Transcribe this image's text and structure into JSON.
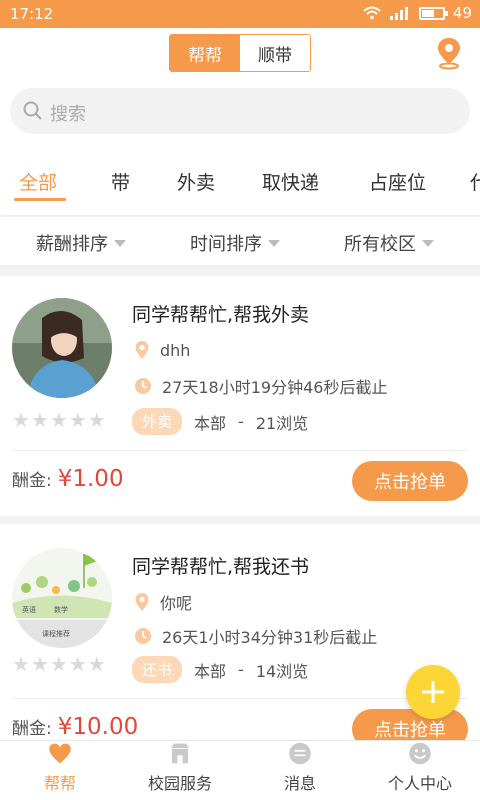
{
  "status_bar": {
    "time": "17:12",
    "battery": "49"
  },
  "header": {
    "segments": [
      "帮帮",
      "顺带"
    ],
    "active_segment": 0
  },
  "search": {
    "placeholder": "搜索"
  },
  "category_tabs": [
    "全部",
    "带",
    "外卖",
    "取快递",
    "占座位",
    "代"
  ],
  "filters": [
    "薪酬排序",
    "时间排序",
    "所有校区"
  ],
  "tasks": [
    {
      "title": "同学帮帮忙,帮我外卖",
      "user": "dhh",
      "deadline": "27天18小时19分钟46秒后截止",
      "tag": "外卖",
      "campus": "本部",
      "separator": "-",
      "views": "21浏览",
      "reward_label": "酬金:",
      "reward": "¥1.00",
      "button": "点击抢单",
      "rating": 0
    },
    {
      "title": "同学帮帮忙,帮我还书",
      "user": "你呢",
      "deadline": "26天1小时34分钟31秒后截止",
      "tag": "还书",
      "campus": "本部",
      "separator": "-",
      "views": "14浏览",
      "reward_label": "酬金:",
      "reward": "¥10.00",
      "button": "点击抢单",
      "rating": 0,
      "thumb_text": [
        "英语",
        "数学",
        "课程推荐"
      ]
    }
  ],
  "bottom_nav": [
    {
      "label": "帮帮",
      "icon": "heart-icon",
      "active": true
    },
    {
      "label": "校园服务",
      "icon": "shop-icon",
      "active": false
    },
    {
      "label": "消息",
      "icon": "message-icon",
      "active": false
    },
    {
      "label": "个人中心",
      "icon": "smile-icon",
      "active": false
    }
  ],
  "colors": {
    "accent": "#f59a4b",
    "price": "#e0493a",
    "fab": "#fcd537"
  }
}
